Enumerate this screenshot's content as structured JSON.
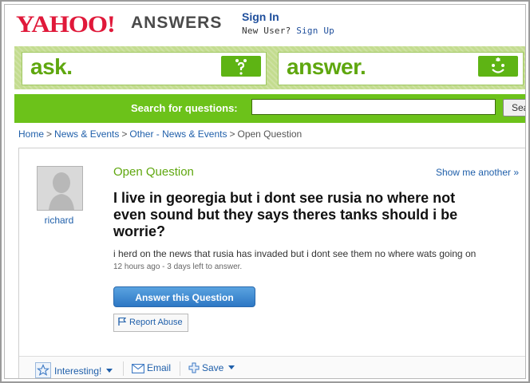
{
  "header": {
    "logo_text": "YAHOO!",
    "logo_sub": "ANSWERS",
    "sign_in": "Sign In",
    "new_user_prefix": "New User?",
    "sign_up": "Sign Up"
  },
  "band": {
    "ask_label": "ask.",
    "answer_label": "answer."
  },
  "search": {
    "label": "Search for questions:",
    "value": "",
    "button_label": "Search"
  },
  "breadcrumb": {
    "items": [
      "Home",
      "News & Events",
      "Other - News & Events"
    ],
    "current": "Open Question"
  },
  "question": {
    "asker": "richard",
    "status": "Open Question",
    "show_another": "Show me another »",
    "title": "I live in georegia but i dont see rusia no where not even sound but they says theres tanks should i be worrie?",
    "body": "i herd on the news that rusia has invaded but i dont see them no where wats going on",
    "meta": "12 hours ago - 3 days left to answer.",
    "answer_button": "Answer this Question",
    "report_abuse": "Report Abuse"
  },
  "actions": {
    "interesting": "Interesting!",
    "email": "Email",
    "save": "Save"
  },
  "colors": {
    "brand_red": "#e0193a",
    "brand_green": "#6cc21a",
    "link_blue": "#1f5faa"
  }
}
